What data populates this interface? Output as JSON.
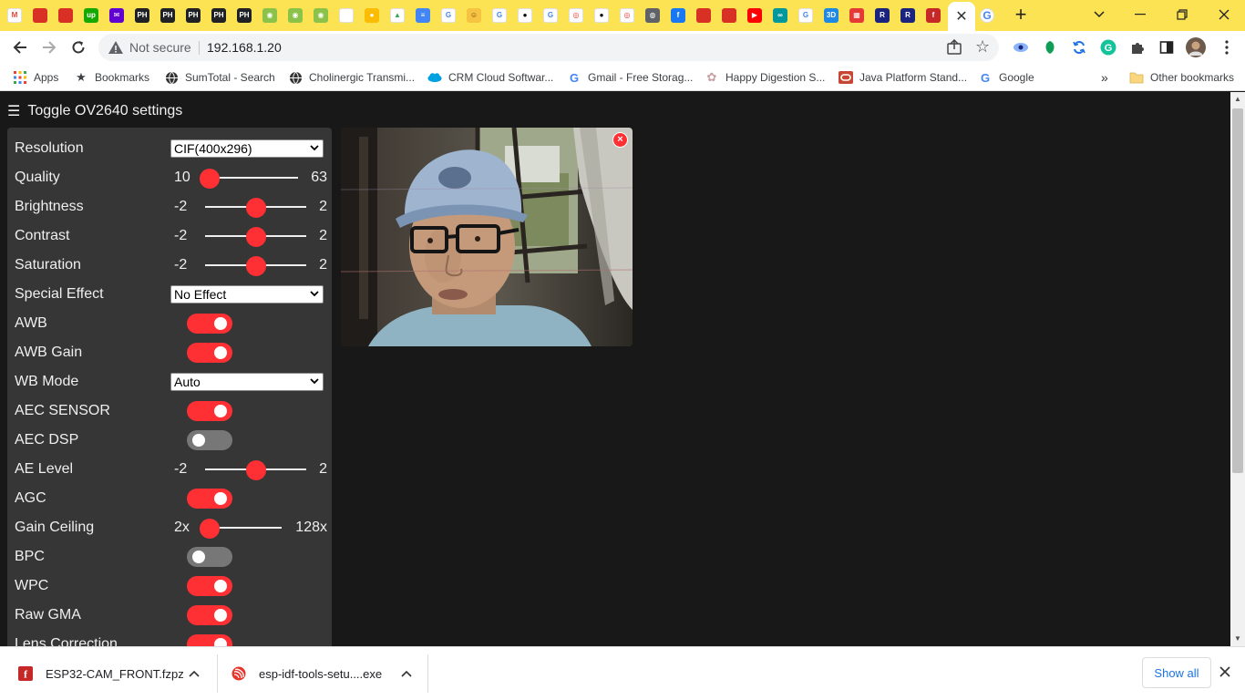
{
  "browser": {
    "tab_favicons": [
      {
        "icon": "gmail-icon",
        "glyph": "M",
        "bg": "#ffffff",
        "fg": "#ea4335"
      },
      {
        "icon": "pdf-icon",
        "glyph": "",
        "bg": "#d93025",
        "fg": "#ffffff"
      },
      {
        "icon": "pdf-icon",
        "glyph": "",
        "bg": "#d93025",
        "fg": "#ffffff"
      },
      {
        "icon": "upwork-icon",
        "glyph": "up",
        "bg": "#14a800",
        "fg": "#ffffff"
      },
      {
        "icon": "mail-icon",
        "glyph": "✉",
        "bg": "#6001d2",
        "fg": "#ffffff"
      },
      {
        "icon": "ph-icon",
        "glyph": "PH",
        "bg": "#202124",
        "fg": "#ffffff"
      },
      {
        "icon": "ph-icon",
        "glyph": "PH",
        "bg": "#202124",
        "fg": "#ffffff"
      },
      {
        "icon": "ph-icon",
        "glyph": "PH",
        "bg": "#202124",
        "fg": "#ffffff"
      },
      {
        "icon": "ph-icon",
        "glyph": "PH",
        "bg": "#202124",
        "fg": "#ffffff"
      },
      {
        "icon": "ph-icon",
        "glyph": "PH",
        "bg": "#202124",
        "fg": "#ffffff"
      },
      {
        "icon": "green-circle-icon",
        "glyph": "◉",
        "bg": "#8bc34a",
        "fg": "#ffffff"
      },
      {
        "icon": "green-circle-icon",
        "glyph": "◉",
        "bg": "#8bc34a",
        "fg": "#ffffff"
      },
      {
        "icon": "green-circle-icon",
        "glyph": "◉",
        "bg": "#8bc34a",
        "fg": "#ffffff"
      },
      {
        "icon": "white-page-icon",
        "glyph": "",
        "bg": "#ffffff",
        "fg": "#cccccc"
      },
      {
        "icon": "keep-icon",
        "glyph": "●",
        "bg": "#fbbc04",
        "fg": "#ffffff"
      },
      {
        "icon": "drive-icon",
        "glyph": "▲",
        "bg": "#ffffff",
        "fg": "#34a853"
      },
      {
        "icon": "docs-icon",
        "glyph": "≡",
        "bg": "#4285f4",
        "fg": "#ffffff"
      },
      {
        "icon": "google-icon",
        "glyph": "G",
        "bg": "#ffffff",
        "fg": "#4285f4"
      },
      {
        "icon": "cartoon-icon",
        "glyph": "☺",
        "bg": "#f6c343",
        "fg": "#6b3e00"
      },
      {
        "icon": "google-icon",
        "glyph": "G",
        "bg": "#ffffff",
        "fg": "#4285f4"
      },
      {
        "icon": "github-icon",
        "glyph": "●",
        "bg": "#ffffff",
        "fg": "#000000"
      },
      {
        "icon": "google-icon",
        "glyph": "G",
        "bg": "#ffffff",
        "fg": "#4285f4"
      },
      {
        "icon": "espressif-icon",
        "glyph": "◎",
        "bg": "#ffffff",
        "fg": "#e7352c"
      },
      {
        "icon": "github-icon",
        "glyph": "●",
        "bg": "#ffffff",
        "fg": "#000000"
      },
      {
        "icon": "espressif-icon",
        "glyph": "◎",
        "bg": "#ffffff",
        "fg": "#e7352c"
      },
      {
        "icon": "globe-icon",
        "glyph": "◍",
        "bg": "#5f6368",
        "fg": "#ffffff"
      },
      {
        "icon": "facebook-icon",
        "glyph": "f",
        "bg": "#1877f2",
        "fg": "#ffffff"
      },
      {
        "icon": "pdf-icon",
        "glyph": "",
        "bg": "#d93025",
        "fg": "#ffffff"
      },
      {
        "icon": "pdf-icon",
        "glyph": "",
        "bg": "#d93025",
        "fg": "#ffffff"
      },
      {
        "icon": "youtube-icon",
        "glyph": "▶",
        "bg": "#ff0000",
        "fg": "#ffffff"
      },
      {
        "icon": "arduino-icon",
        "glyph": "∞",
        "bg": "#00979d",
        "fg": "#ffffff"
      },
      {
        "icon": "google-icon",
        "glyph": "G",
        "bg": "#ffffff",
        "fg": "#4285f4"
      },
      {
        "icon": "3d-icon",
        "glyph": "3D",
        "bg": "#1e88e5",
        "fg": "#ffffff"
      },
      {
        "icon": "grid-icon",
        "glyph": "▦",
        "bg": "#e53935",
        "fg": "#ffffff"
      },
      {
        "icon": "r-icon",
        "glyph": "R",
        "bg": "#1a237e",
        "fg": "#ffffff"
      },
      {
        "icon": "r-icon",
        "glyph": "R",
        "bg": "#1a237e",
        "fg": "#ffffff"
      },
      {
        "icon": "fritzing-icon",
        "glyph": "f",
        "bg": "#c62828",
        "fg": "#ffffff"
      }
    ],
    "active_tab_close": "✕",
    "after_tab_favicon": {
      "icon": "google-icon",
      "glyph": "G"
    },
    "new_tab": "+",
    "url": "192.168.1.20",
    "security_label": "Not secure",
    "bookmarks": [
      {
        "label": "Apps",
        "icon": "apps-grid-icon"
      },
      {
        "label": "Bookmarks",
        "icon": "star-icon"
      },
      {
        "label": "SumTotal - Search",
        "icon": "globe-icon"
      },
      {
        "label": "Cholinergic Transmi...",
        "icon": "globe-icon"
      },
      {
        "label": "CRM Cloud Softwar...",
        "icon": "salesforce-cloud-icon"
      },
      {
        "label": "Gmail - Free Storag...",
        "icon": "google-icon"
      },
      {
        "label": "Happy Digestion S...",
        "icon": "flower-icon"
      },
      {
        "label": "Java Platform Stand...",
        "icon": "oracle-icon"
      },
      {
        "label": "Google",
        "icon": "google-icon"
      }
    ],
    "bookmarks_more": "»",
    "other_bookmarks": "Other bookmarks"
  },
  "page": {
    "toggle_label": "Toggle OV2640 settings",
    "settings": [
      {
        "label": "Resolution",
        "type": "select",
        "value": "CIF(400x296)"
      },
      {
        "label": "Quality",
        "type": "range",
        "min": "10",
        "max": "63",
        "fraction": 0.0
      },
      {
        "label": "Brightness",
        "type": "range",
        "min": "-2",
        "max": "2",
        "fraction": 0.5
      },
      {
        "label": "Contrast",
        "type": "range",
        "min": "-2",
        "max": "2",
        "fraction": 0.5
      },
      {
        "label": "Saturation",
        "type": "range",
        "min": "-2",
        "max": "2",
        "fraction": 0.5
      },
      {
        "label": "Special Effect",
        "type": "select",
        "value": "No Effect"
      },
      {
        "label": "AWB",
        "type": "switch",
        "on": true
      },
      {
        "label": "AWB Gain",
        "type": "switch",
        "on": true
      },
      {
        "label": "WB Mode",
        "type": "select",
        "value": "Auto"
      },
      {
        "label": "AEC SENSOR",
        "type": "switch",
        "on": true
      },
      {
        "label": "AEC DSP",
        "type": "switch",
        "on": false
      },
      {
        "label": "AE Level",
        "type": "range",
        "min": "-2",
        "max": "2",
        "fraction": 0.5
      },
      {
        "label": "AGC",
        "type": "switch",
        "on": true
      },
      {
        "label": "Gain Ceiling",
        "type": "range",
        "min": "2x",
        "max": "128x",
        "fraction": 0.0
      },
      {
        "label": "BPC",
        "type": "switch",
        "on": false
      },
      {
        "label": "WPC",
        "type": "switch",
        "on": true
      },
      {
        "label": "Raw GMA",
        "type": "switch",
        "on": true
      },
      {
        "label": "Lens Correction",
        "type": "switch",
        "on": true
      }
    ],
    "accent": "#ff3034"
  },
  "downloads": {
    "items": [
      {
        "name": "ESP32-CAM_FRONT.fzpz",
        "icon": "fritzing-icon"
      },
      {
        "name": "esp-idf-tools-setu....exe",
        "icon": "espressif-icon"
      }
    ],
    "show_all": "Show all"
  }
}
